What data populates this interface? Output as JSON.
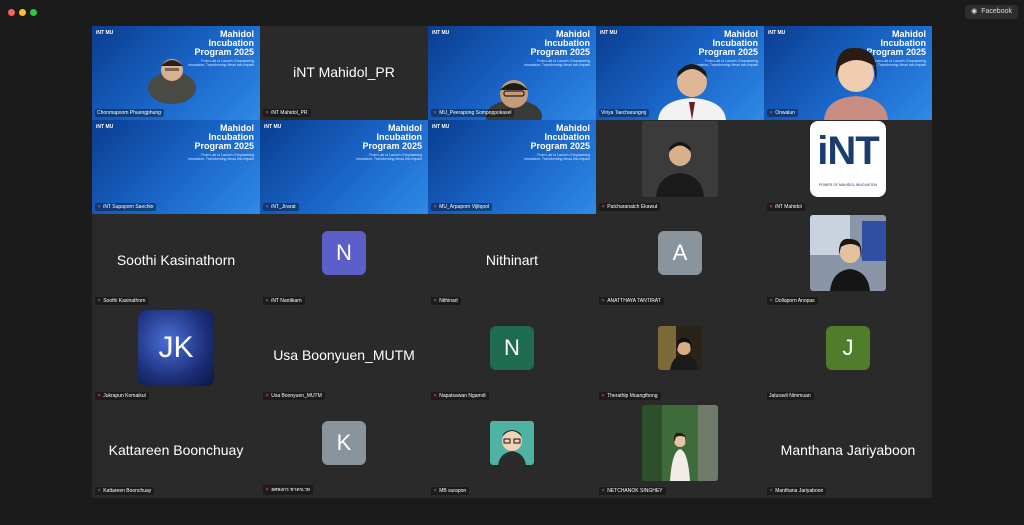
{
  "toolbar": {
    "facebook_label": "Facebook"
  },
  "banner": {
    "logo": "iNT MU",
    "title_line1": "Mahidol",
    "title_line2": "Incubation",
    "title_line3": "Program 2025",
    "subtitle": "From Lab to Launch: Empowering Innovation, Transforming Ideas into Impact"
  },
  "participants": [
    {
      "name": "Chonmapoom Phuengphung"
    },
    {
      "name": "iNT Mahidol_PR",
      "display": "iNT Mahidol_PR"
    },
    {
      "name": "MU_Peerapong Sompoppokasel"
    },
    {
      "name": "Viriya Taecharungroj"
    },
    {
      "name": "Onwalun"
    },
    {
      "name": "iNT Supaporn Saechio"
    },
    {
      "name": "iNT_Jirarat"
    },
    {
      "name": "MU_Arpaporn Vijitqool"
    },
    {
      "name": "Patcharanatch Ekawut"
    },
    {
      "name": "iNT Mahidol",
      "logo_text": "iNT",
      "logo_caption": "POWER OF MAHIDOL INNOVATION"
    },
    {
      "name": "Soothi Kasinathorn",
      "display": "Soothi Kasinathorn"
    },
    {
      "name": "iNT Nantikarn",
      "initial": "N"
    },
    {
      "name": "Nithinart",
      "display": "Nithinart"
    },
    {
      "name": "ANATTHAYA TANTIRAT",
      "initial": "A"
    },
    {
      "name": "Dollaporn Anopas"
    },
    {
      "name": "Jukrapun Komaikul",
      "initial": "JK"
    },
    {
      "name": "Usa Boonyuen_MUTM",
      "display": "Usa Boonyuen_MUTM"
    },
    {
      "name": "Napatsawan Ngamdi",
      "initial": "N"
    },
    {
      "name": "Therathip Muangthong"
    },
    {
      "name": "Jaturavit Nimmuan",
      "initial": "J"
    },
    {
      "name": "Kattareen Boonchuay",
      "display": "Kattareen Boonchuay"
    },
    {
      "name": "ยศพงกร ชาตรเวท",
      "initial": "K"
    },
    {
      "name": "MB surapon"
    },
    {
      "name": "NETCHANOK SINGHEY"
    },
    {
      "name": "Manthana Jariyaboon",
      "display": "Manthana Jariyaboon"
    }
  ],
  "colors": {
    "muted_mic": "#e5484d",
    "active_speaker": "#8fd14f",
    "avatar_nantikarn": "#5b5fc7",
    "avatar_anatthaya": "#8a949c",
    "avatar_napatsawan": "#1f6b4f",
    "avatar_jaturavit": "#4f7d2b",
    "avatar_k": "#8a949c"
  }
}
